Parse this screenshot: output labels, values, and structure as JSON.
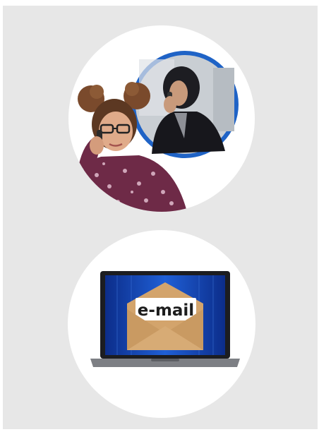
{
  "illustrations": [
    {
      "id": "phone-call",
      "icon": "phone-call-illustration"
    },
    {
      "id": "email",
      "icon": "laptop-email-illustration",
      "label": "email"
    }
  ],
  "email_label": "e-mail",
  "colors": {
    "background": "#e7e7e7",
    "circle": "#ffffff",
    "accent_blue": "#1f63c6",
    "envelope": "#d3a46c"
  }
}
